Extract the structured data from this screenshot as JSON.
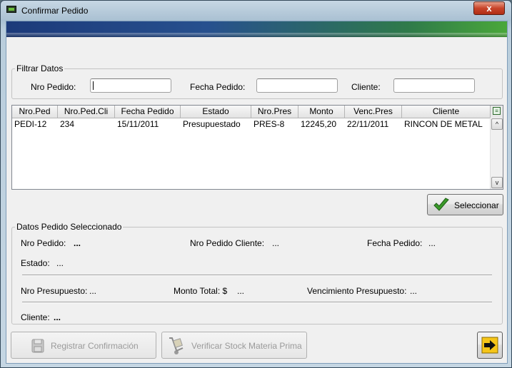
{
  "window": {
    "title": "Confirmar Pedido",
    "close_glyph": "x"
  },
  "filter": {
    "legend": "Filtrar Datos",
    "nro_pedido_label": "Nro Pedido:",
    "nro_pedido_value": "",
    "fecha_pedido_label": "Fecha Pedido:",
    "fecha_pedido_value": "",
    "cliente_label": "Cliente:",
    "cliente_value": ""
  },
  "table": {
    "columns": [
      "Nro.Ped",
      "Nro.Ped.Cli",
      "Fecha Pedido",
      "Estado",
      "Nro.Pres",
      "Monto",
      "Venc.Pres",
      "Cliente"
    ],
    "rows": [
      [
        "PEDI-12",
        "234",
        "15/11/2011",
        "Presupuestado",
        "PRES-8",
        "12245,20",
        "22/11/2011",
        "RINCON DE METAL"
      ]
    ],
    "scroll_up_glyph": "^",
    "scroll_down_glyph": "v"
  },
  "select_button": {
    "label": "Seleccionar",
    "icon": "check-icon"
  },
  "details": {
    "legend": "Datos Pedido Seleccionado",
    "nro_pedido_label": "Nro Pedido:",
    "nro_pedido_value": "...",
    "nro_pedido_cliente_label": "Nro Pedido Cliente:",
    "nro_pedido_cliente_value": "...",
    "fecha_pedido_label": "Fecha Pedido:",
    "fecha_pedido_value": "...",
    "estado_label": "Estado:",
    "estado_value": "...",
    "nro_presupuesto_label": "Nro Presupuesto:",
    "nro_presupuesto_value": "...",
    "monto_total_label": "Monto Total: $",
    "monto_total_value": "...",
    "vencimiento_label": "Vencimiento Presupuesto:",
    "vencimiento_value": "...",
    "cliente_label": "Cliente:",
    "cliente_value": "..."
  },
  "footer": {
    "registrar_label": "Registrar Confirmación",
    "verificar_label": "Verificar Stock Materia Prima",
    "exit_icon": "exit-arrow-icon"
  },
  "colors": {
    "accent_green": "#4aa83a",
    "banner_blue": "#1c3a7a",
    "exit_yellow": "#f5c518"
  }
}
